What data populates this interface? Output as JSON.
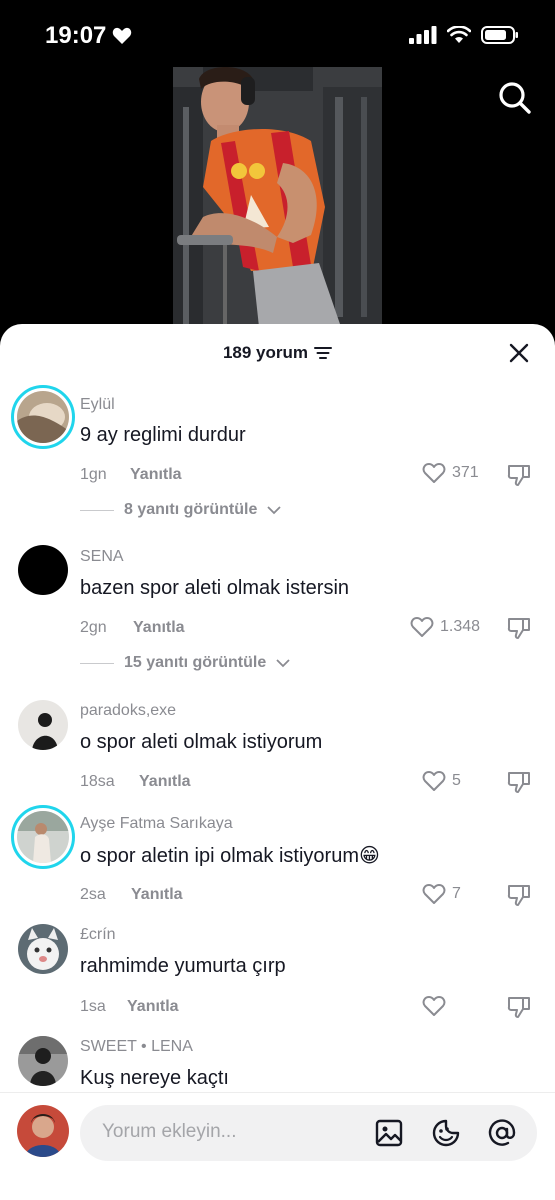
{
  "status_bar": {
    "time": "19:07"
  },
  "sheet": {
    "title": "189 yorum",
    "comments": [
      {
        "username": "Eylül",
        "text": "9 ay reglimi durdur",
        "time": "1gn",
        "reply_label": "Yanıtla",
        "likes": "371",
        "view_replies": "8 yanıtı görüntüle"
      },
      {
        "username": "SENA",
        "text": "bazen spor aleti olmak istersin",
        "time": "2gn",
        "reply_label": "Yanıtla",
        "likes": "1.348",
        "view_replies": "15 yanıtı görüntüle"
      },
      {
        "username": "paradoks,exe",
        "text": "o spor aleti olmak istiyorum",
        "time": "18sa",
        "reply_label": "Yanıtla",
        "likes": "5"
      },
      {
        "username": "Ayşe Fatma Sarıkaya",
        "text": "o spor aletin ipi olmak istiyorum😁",
        "time": "2sa",
        "reply_label": "Yanıtla",
        "likes": "7"
      },
      {
        "username": "£crín",
        "text": "rahmimde yumurta çırp",
        "time": "1sa",
        "reply_label": "Yanıtla",
        "likes": ""
      },
      {
        "username": "SWEET • LENA",
        "text": "Kuş nereye kaçtı"
      }
    ]
  },
  "input": {
    "placeholder": "Yorum ekleyin..."
  },
  "icons": {
    "status": [
      "heart-icon",
      "signal-icon",
      "wifi-icon",
      "battery-icon"
    ],
    "search": "search-icon",
    "close": "close-icon",
    "sort": "sort-icon",
    "like": "heart-outline-icon",
    "dislike": "dislike-icon",
    "chevron": "chevron-down-icon",
    "input": [
      "image-icon",
      "emoji-icon",
      "mention-icon"
    ]
  },
  "colors": {
    "accent_ring": "#20d5ec",
    "text_secondary": "#8a8b91",
    "sheet_bg": "#ffffff"
  }
}
